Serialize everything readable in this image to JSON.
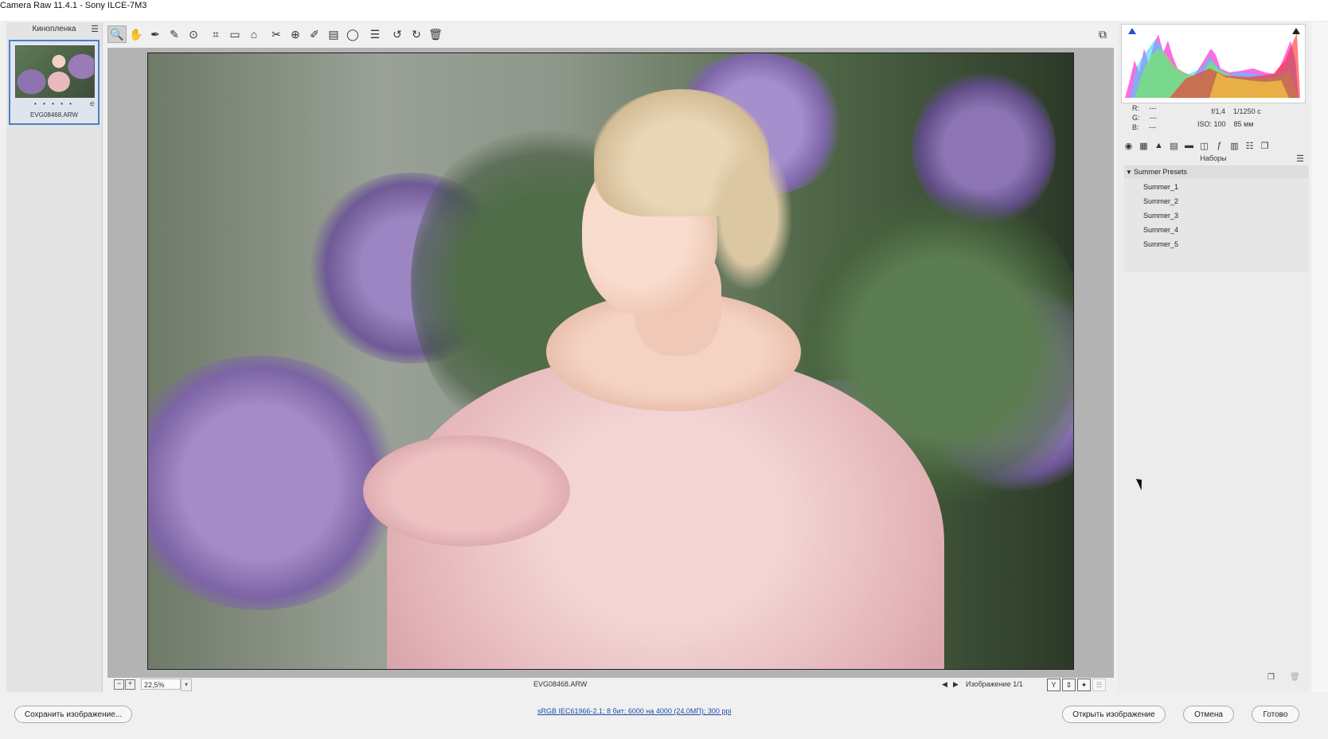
{
  "window": {
    "title": "Camera Raw 11.4.1  -  Sony ILCE-7M3"
  },
  "filmstrip": {
    "header": "Кинопленка",
    "thumbnail": {
      "stars": "• • • • •",
      "filename": "EVG08468.ARW"
    }
  },
  "toolbar": {
    "tools": [
      {
        "name": "zoom-tool-icon",
        "glyph": "🔍"
      },
      {
        "name": "hand-tool-icon",
        "glyph": "✋"
      },
      {
        "name": "white-balance-tool-icon",
        "glyph": "✒"
      },
      {
        "name": "color-sampler-tool-icon",
        "glyph": "✎"
      },
      {
        "name": "targeted-adjustment-tool-icon",
        "glyph": "⊙"
      },
      {
        "name": "crop-tool-icon",
        "glyph": "⌗"
      },
      {
        "name": "straighten-tool-icon",
        "glyph": "▭"
      },
      {
        "name": "transform-tool-icon",
        "glyph": "⌂"
      },
      {
        "name": "spot-removal-tool-icon",
        "glyph": "✂"
      },
      {
        "name": "red-eye-tool-icon",
        "glyph": "⊕"
      },
      {
        "name": "adjustment-brush-icon",
        "glyph": "✐"
      },
      {
        "name": "graduated-filter-icon",
        "glyph": "▤"
      },
      {
        "name": "radial-filter-icon",
        "glyph": "◯"
      },
      {
        "name": "preferences-icon",
        "glyph": "☰"
      },
      {
        "name": "rotate-left-icon",
        "glyph": "↺"
      },
      {
        "name": "rotate-right-icon",
        "glyph": "↻"
      },
      {
        "name": "delete-icon",
        "glyph": "🗑"
      }
    ]
  },
  "status": {
    "zoom": "22,5%",
    "filename": "EVG08468.ARW",
    "image_count": "Изображение 1/1"
  },
  "info": {
    "r_label": "R:",
    "r_value": "---",
    "g_label": "G:",
    "g_value": "---",
    "b_label": "B:",
    "b_value": "---",
    "aperture": "f/1,4",
    "shutter": "1/1250 с",
    "iso": "ISO: 100",
    "focal": "85 мм"
  },
  "presets": {
    "title": "Наборы",
    "group": "Summer Presets",
    "items": [
      "Summer_1",
      "Summer_2",
      "Summer_3",
      "Summer_4",
      "Summer_5"
    ]
  },
  "bottom": {
    "save_label": "Сохранить изображение...",
    "workflow_info": "sRGB IEC61966-2.1; 8 бит; 6000 на 4000 (24,0МП); 300 ppi",
    "open_label": "Открыть изображение",
    "cancel_label": "Отмена",
    "done_label": "Готово"
  },
  "colors": {
    "accent": "#4a7fc9",
    "link": "#1a4da8"
  }
}
